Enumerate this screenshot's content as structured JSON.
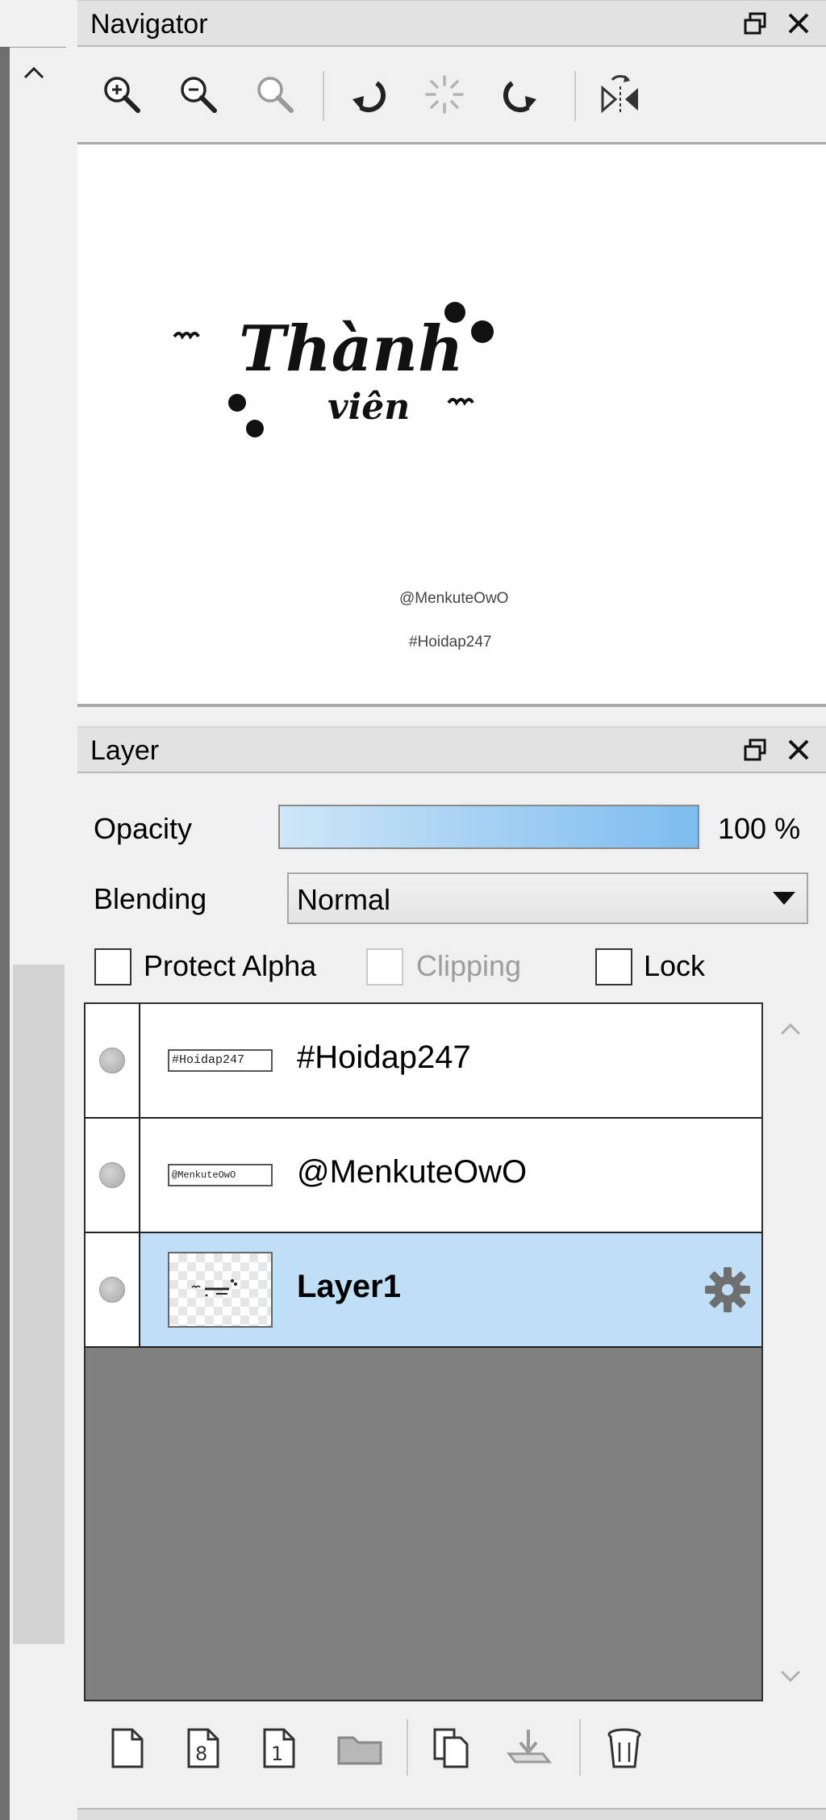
{
  "navigator": {
    "title": "Navigator",
    "toolbar": {
      "icons": [
        "zoom-in-icon",
        "zoom-out-icon",
        "zoom-reset-icon",
        "rotate-left-icon",
        "rotate-reset-icon",
        "rotate-right-icon",
        "flip-horizontal-icon"
      ]
    },
    "preview": {
      "artwork_words": [
        "Thành",
        "viên"
      ],
      "handle_text": "@MenkuteOwO",
      "tag_text": "#Hoidap247"
    }
  },
  "layer_panel": {
    "title": "Layer",
    "opacity_label": "Opacity",
    "opacity_value": "100 %",
    "opacity_fraction": 1.0,
    "blending_label": "Blending",
    "blending_value": "Normal",
    "protect_alpha_label": "Protect Alpha",
    "clipping_label": "Clipping",
    "lock_label": "Lock",
    "layers": [
      {
        "name": "#Hoidap247",
        "thumb_text": "#Hoidap247",
        "selected": false
      },
      {
        "name": "@MenkuteOwO",
        "thumb_text": "@MenkuteOwO",
        "selected": false
      },
      {
        "name": "Layer1",
        "thumb_text": "",
        "selected": true
      }
    ],
    "bottom_toolbar": {
      "icons": [
        "new-layer-icon",
        "new-8bit-layer-icon",
        "new-1bit-layer-icon",
        "new-folder-icon",
        "duplicate-layer-icon",
        "merge-down-icon",
        "delete-layer-icon"
      ],
      "new_8bit_glyph": "8",
      "new_1bit_glyph": "1"
    }
  },
  "colors": {
    "selected_row": "#bfdff7",
    "opacity_fill": "#7cbcf0",
    "list_background": "#808080"
  }
}
